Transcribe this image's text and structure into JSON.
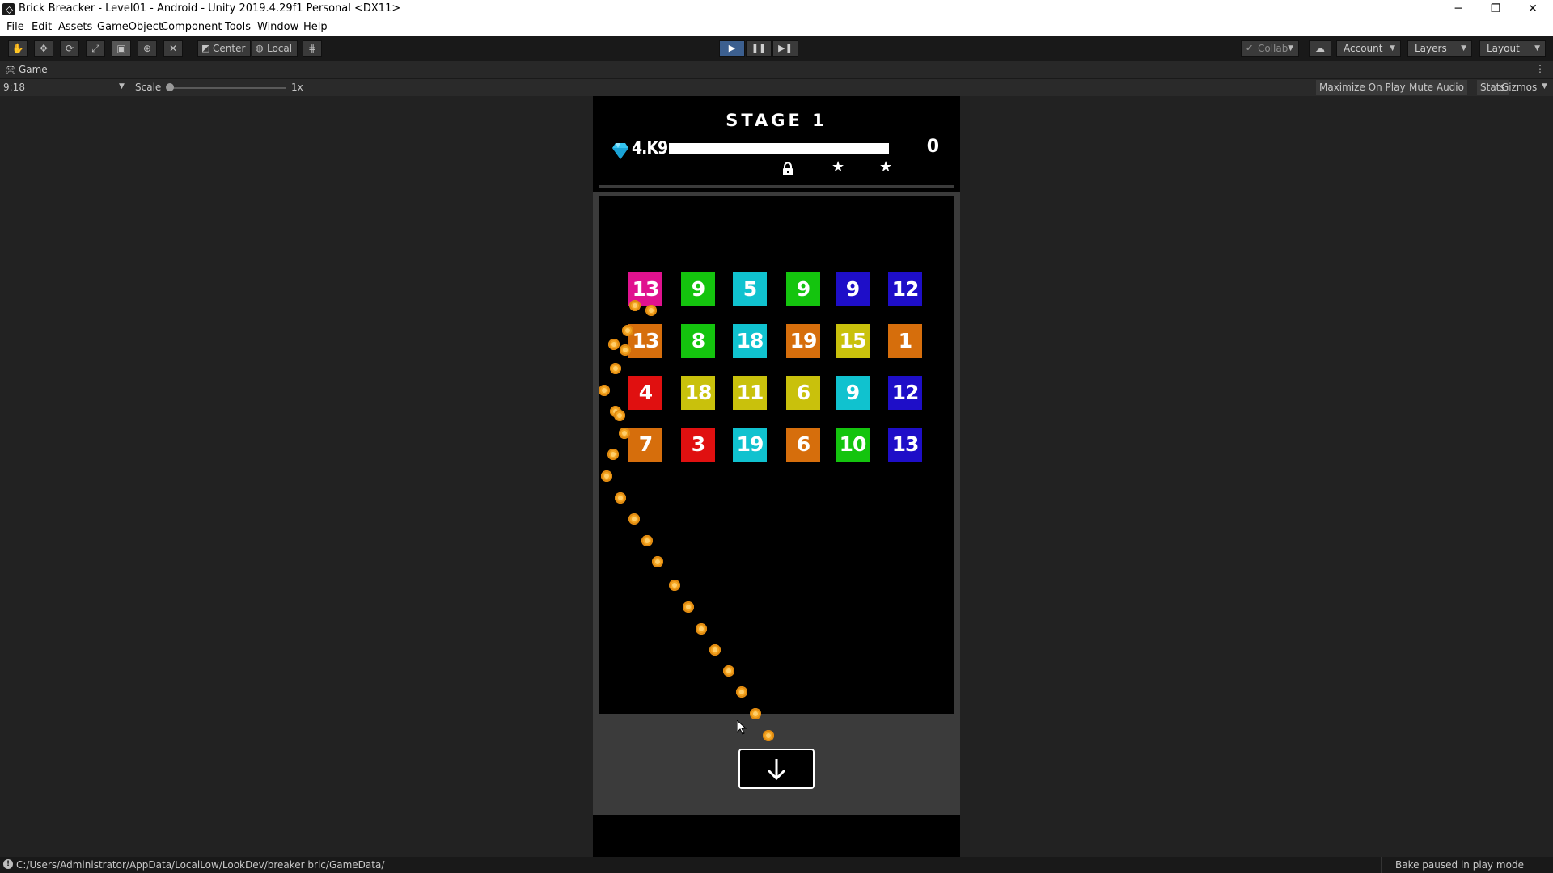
{
  "window": {
    "title": "Brick Breacker - Level01 - Android - Unity 2019.4.29f1 Personal <DX11>",
    "controls": {
      "minimize": "─",
      "restore": "❐",
      "close": "✕"
    }
  },
  "menu": [
    "File",
    "Edit",
    "Assets",
    "GameObject",
    "Component",
    "Tools",
    "Window",
    "Help"
  ],
  "toolbar": {
    "tools": [
      "hand-icon",
      "move-icon",
      "rotate-icon",
      "scale-icon",
      "rect-icon",
      "transform-icon",
      "custom-tool-icon"
    ],
    "pivot": "Center",
    "pivot_rotation": "Local",
    "playback": {
      "play": "▶",
      "pause": "❚❚",
      "step": "▶❚"
    },
    "collab": "Collab",
    "account": "Account",
    "layers": "Layers",
    "layout": "Layout"
  },
  "game_tab": {
    "label": "Game"
  },
  "game_controls": {
    "aspect": "9:18",
    "scale_label": "Scale",
    "scale_value": "1x",
    "maximize": "Maximize On Play",
    "mute": "Mute Audio",
    "stats": "Stats",
    "gizmos": "Gizmos"
  },
  "game": {
    "stage_title": "STAGE 1",
    "gems": "4.K9",
    "score": "0",
    "progress": 0,
    "brick_colors": {
      "magenta": "#e0128f",
      "green": "#14c40e",
      "cyan": "#10c2cf",
      "blue": "#1e0ec8",
      "orange": "#d66e0c",
      "yellow": "#c9c10c",
      "red": "#e01010"
    },
    "bricks": [
      [
        {
          "value": "13",
          "color": "magenta"
        },
        {
          "value": "9",
          "color": "green"
        },
        {
          "value": "5",
          "color": "cyan"
        },
        {
          "value": "9",
          "color": "green"
        },
        {
          "value": "9",
          "color": "blue"
        },
        {
          "value": "12",
          "color": "blue"
        }
      ],
      [
        {
          "value": "13",
          "color": "orange"
        },
        {
          "value": "8",
          "color": "green"
        },
        {
          "value": "18",
          "color": "cyan"
        },
        {
          "value": "19",
          "color": "orange"
        },
        {
          "value": "15",
          "color": "yellow"
        },
        {
          "value": "1",
          "color": "orange"
        }
      ],
      [
        {
          "value": "4",
          "color": "red"
        },
        {
          "value": "18",
          "color": "yellow"
        },
        {
          "value": "11",
          "color": "yellow"
        },
        {
          "value": "6",
          "color": "yellow"
        },
        {
          "value": "9",
          "color": "cyan"
        },
        {
          "value": "12",
          "color": "blue"
        }
      ],
      [
        {
          "value": "7",
          "color": "orange"
        },
        {
          "value": "3",
          "color": "red"
        },
        {
          "value": "19",
          "color": "cyan"
        },
        {
          "value": "6",
          "color": "orange"
        },
        {
          "value": "10",
          "color": "green"
        },
        {
          "value": "13",
          "color": "blue"
        }
      ]
    ],
    "drop_button_icon": "arrow-down-icon"
  },
  "status": {
    "path": "C:/Users/Administrator/AppData/LocalLow/LookDev/breaker bric/GameData/",
    "bake": "Bake paused in play mode"
  }
}
